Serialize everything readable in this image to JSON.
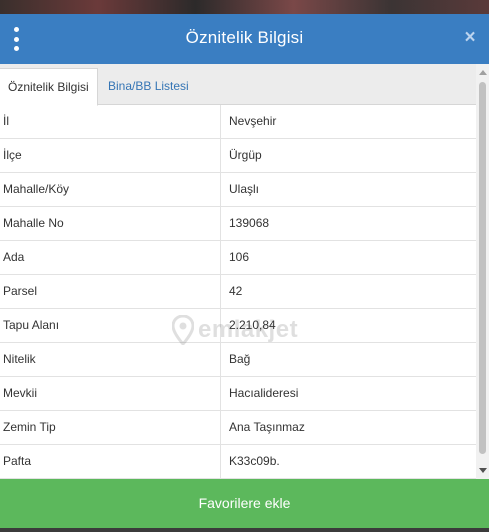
{
  "dialog": {
    "title": "Öznitelik Bilgisi",
    "close_glyph": "×",
    "menu_icon": "vertical-ellipsis-icon",
    "accent_color": "#3a7ec2"
  },
  "tabs": [
    {
      "label": "Öznitelik Bilgisi",
      "active": true
    },
    {
      "label": "Bina/BB Listesi",
      "active": false
    }
  ],
  "attributes": [
    {
      "label": "İl",
      "value": "Nevşehir"
    },
    {
      "label": "İlçe",
      "value": "Ürgüp"
    },
    {
      "label": "Mahalle/Köy",
      "value": "Ulaşlı"
    },
    {
      "label": "Mahalle No",
      "value": "139068"
    },
    {
      "label": "Ada",
      "value": "106"
    },
    {
      "label": "Parsel",
      "value": "42"
    },
    {
      "label": "Tapu Alanı",
      "value": "2.210,84"
    },
    {
      "label": "Nitelik",
      "value": "Bağ"
    },
    {
      "label": "Mevkii",
      "value": "Hacıalideresi"
    },
    {
      "label": "Zemin Tip",
      "value": "Ana Taşınmaz"
    },
    {
      "label": "Pafta",
      "value": "K33c09b."
    }
  ],
  "watermark": {
    "text": "emlakjet",
    "icon": "location-pin-icon"
  },
  "footer": {
    "button_label": "Favorilere ekle",
    "color": "#5cb85c"
  }
}
